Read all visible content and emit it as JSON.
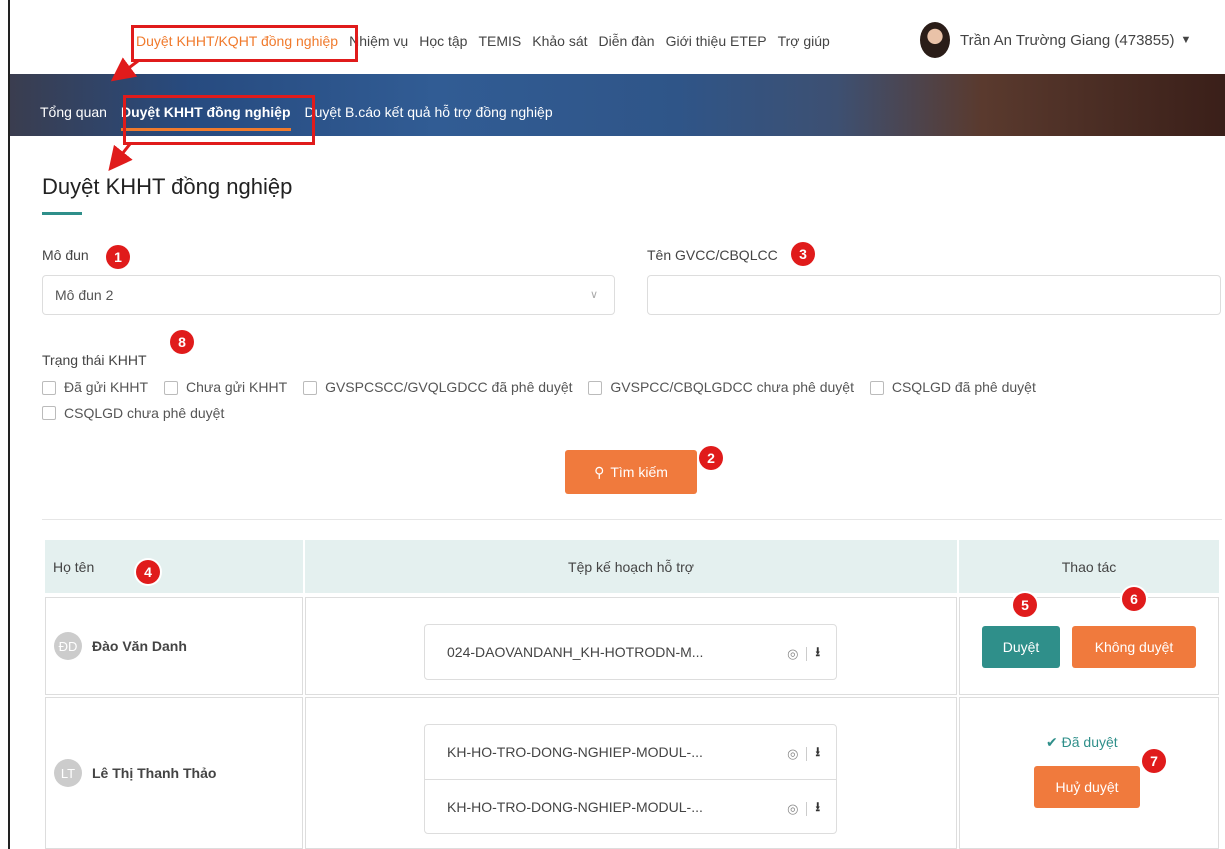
{
  "topnav": {
    "items": [
      "Duyệt KHHT/KQHT đồng nghiệp",
      "Nhiệm vụ",
      "Học tập",
      "TEMIS",
      "Khảo sát",
      "Diễn đàn",
      "Giới thiệu ETEP",
      "Trợ giúp"
    ],
    "user": "Trần An Trường Giang (473855)"
  },
  "subnav": {
    "items": [
      "Tổng quan",
      "Duyệt KHHT đồng nghiệp",
      "Duyệt B.cáo kết quả hỗ trợ đồng nghiệp"
    ]
  },
  "page": {
    "title": "Duyệt KHHT đồng nghiệp",
    "module_label": "Mô đun",
    "module_value": "Mô đun 2",
    "name_label": "Tên GVCC/CBQLCC",
    "name_value": "",
    "status_label": "Trạng thái KHHT",
    "statuses": [
      "Đã gửi KHHT",
      "Chưa gửi KHHT",
      "GVSPCSCC/GVQLGDCC đã phê duyệt",
      "GVSPCC/CBQLGDCC chưa phê duyệt",
      "CSQLGD đã phê duyệt",
      "CSQLGD chưa phê duyệt"
    ],
    "search_label": "Tìm kiếm"
  },
  "table": {
    "headers": [
      "Họ tên",
      "Tệp kế hoạch hỗ trợ",
      "Thao tác"
    ],
    "rows": [
      {
        "initials": "ĐD",
        "name": "Đào Văn Danh",
        "files": [
          "024-DAOVANDANH_KH-HOTRODN-M..."
        ],
        "actions": [
          "Duyệt",
          "Không duyệt"
        ]
      },
      {
        "initials": "LT",
        "name": "Lê Thị Thanh Thảo",
        "files": [
          "KH-HO-TRO-DONG-NGHIEP-MODUL-...",
          "KH-HO-TRO-DONG-NGHIEP-MODUL-..."
        ],
        "status": "Đã duyệt",
        "actions": [
          "Huỷ duyệt"
        ]
      }
    ]
  },
  "badges": [
    "1",
    "2",
    "3",
    "4",
    "5",
    "6",
    "7",
    "8"
  ],
  "colors": {
    "accent": "#f07a3d",
    "teal": "#2f8f8a",
    "annotation": "#e01b1b"
  }
}
